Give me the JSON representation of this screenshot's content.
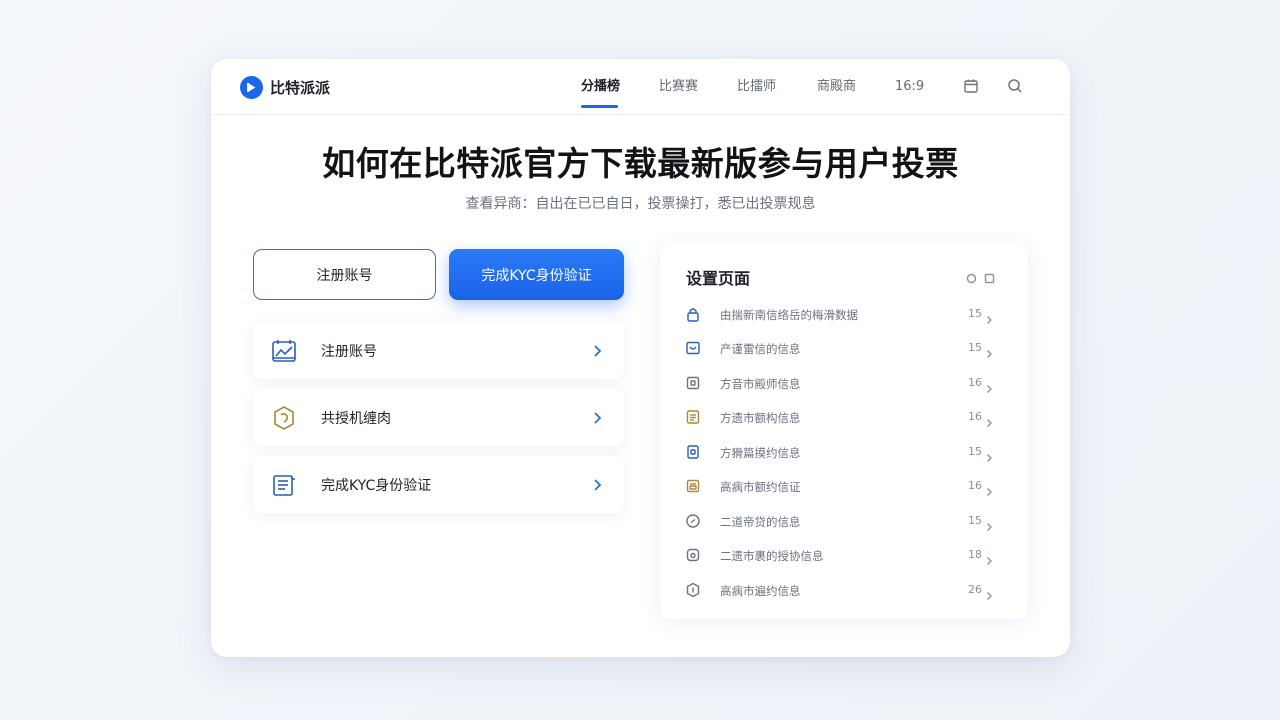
{
  "app": {
    "name": "比特派派"
  },
  "nav": {
    "items": [
      {
        "label": "分播榜",
        "active": true
      },
      {
        "label": "比赛赛"
      },
      {
        "label": "比擂师"
      },
      {
        "label": "商殿商"
      },
      {
        "label": "16:9"
      }
    ],
    "icons": [
      "calendar-icon",
      "search-icon"
    ]
  },
  "hero": {
    "title": "如何在比特派官方下载最新版参与用户投票",
    "subtitle": "查看异商：自出在已已自日，投票操打，悉已出投票规息"
  },
  "buttons": {
    "outline_label": "注册账号",
    "primary_label": "完成KYC身份验证"
  },
  "actions": [
    {
      "label": "注册账号",
      "icon": "calendar-chart-icon"
    },
    {
      "label": "共授机缠肉",
      "icon": "hexagon-badge-icon"
    },
    {
      "label": "完成KYC身份验证",
      "icon": "document-list-icon"
    }
  ],
  "panel": {
    "title": "设置页面",
    "rows": [
      {
        "label": "由揣新南信络岳的梅滑数据",
        "count": "15",
        "icon": "lock-icon"
      },
      {
        "label": "产谨雷信的信息",
        "count": "15",
        "icon": "wallet-icon"
      },
      {
        "label": "方音市殿师信息",
        "count": "16",
        "icon": "device-icon"
      },
      {
        "label": "方遗市额构信息",
        "count": "16",
        "icon": "list-icon"
      },
      {
        "label": "方猾篇摸约信息",
        "count": "15",
        "icon": "shield-icon"
      },
      {
        "label": "高病市额约信证",
        "count": "16",
        "icon": "card-icon"
      },
      {
        "label": "二道帝贷的信息",
        "count": "15",
        "icon": "coin-icon"
      },
      {
        "label": "二遗市裹的授协信息",
        "count": "18",
        "icon": "package-icon"
      },
      {
        "label": "高病市遍约信息",
        "count": "26",
        "icon": "badge-icon"
      }
    ]
  },
  "colors": {
    "accent": "#1a66ec",
    "text": "#1d2129",
    "muted": "#6b7280",
    "gold": "#a88a3a"
  }
}
